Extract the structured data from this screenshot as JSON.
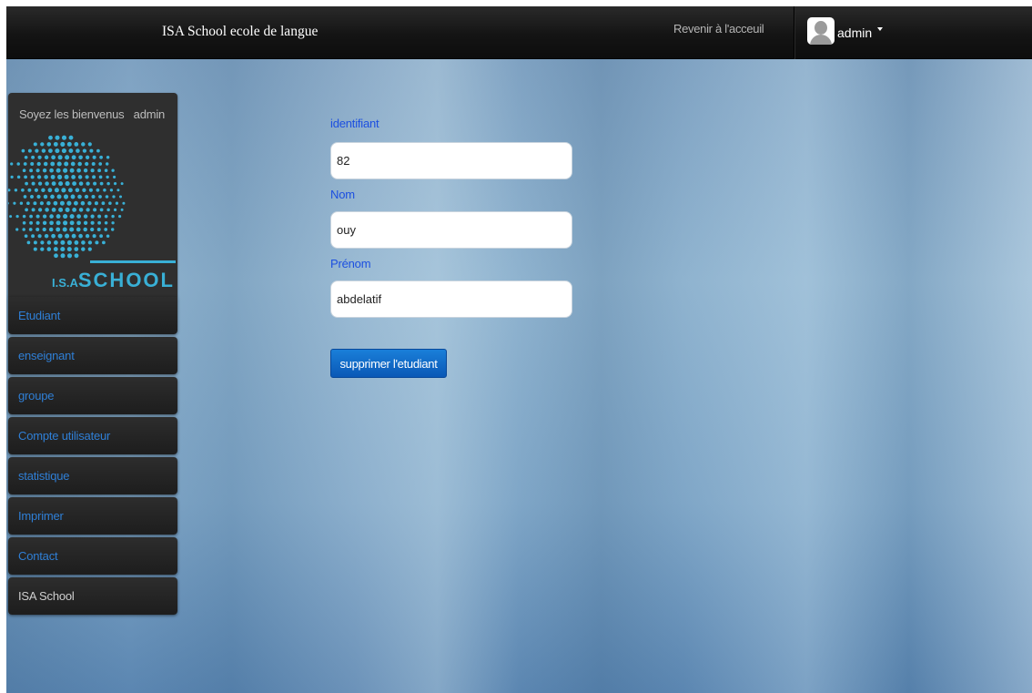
{
  "navbar": {
    "brand": "ISA School ecole de langue",
    "home_link": "Revenir à l'acceuil",
    "user": {
      "name": "admin",
      "icon": "user-avatar-icon"
    }
  },
  "sidebar": {
    "welcome": "Soyez les bienvenus   admin",
    "logo": {
      "text_small": "I.S.A",
      "text_large": "SCHOOL"
    },
    "items": [
      {
        "label": "Etudiant"
      },
      {
        "label": "enseignant"
      },
      {
        "label": "groupe"
      },
      {
        "label": "Compte utilisateur"
      },
      {
        "label": "statistique"
      },
      {
        "label": "Imprimer"
      },
      {
        "label": "Contact"
      },
      {
        "label": "ISA School"
      }
    ]
  },
  "form": {
    "fields": [
      {
        "label": "identifiant",
        "value": "82"
      },
      {
        "label": "Nom",
        "value": "ouy"
      },
      {
        "label": "Prénom",
        "value": "abdelatif"
      }
    ],
    "submit_label": "supprimer l'etudiant"
  },
  "colors": {
    "navbar_bg": "#141414",
    "link_blue": "#2f7fd6",
    "label_blue": "#1c4fe0",
    "logo_cyan": "#39b0d6",
    "button_blue": "#0a58b6"
  }
}
